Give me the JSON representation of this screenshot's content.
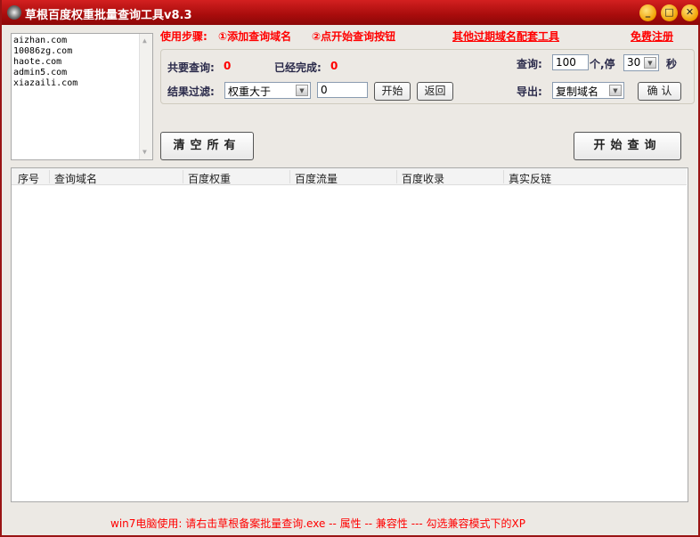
{
  "window": {
    "title": "草根百度权重批量查询工具v8.3"
  },
  "domains": [
    "aizhan.com",
    "10086zg.com",
    "haote.com",
    "admin5.com",
    "xiazaili.com"
  ],
  "steps": {
    "label": "使用步骤:",
    "step1": "①添加查询域名",
    "step2": "②点开始查询按钮"
  },
  "links": {
    "tools": "其他过期域名配套工具",
    "register": "免费注册"
  },
  "stats": {
    "total_label": "共要查询:",
    "total": "0",
    "done_label": "已经完成:",
    "done": "0"
  },
  "filter": {
    "label": "结果过滤:",
    "selected": "权重大于",
    "value": "0",
    "start": "开始",
    "back": "返回"
  },
  "query": {
    "label": "查询:",
    "count": "100",
    "mid": "个,停",
    "pause": "30",
    "unit": "秒"
  },
  "export": {
    "label": "导出:",
    "selected": "复制域名",
    "confirm": "确 认"
  },
  "buttons": {
    "clear": "清空所有",
    "start": "开始查询"
  },
  "table": {
    "columns": [
      "序号",
      "查询域名",
      "百度权重",
      "百度流量",
      "百度收录",
      "真实反链"
    ]
  },
  "footer": "win7电脑使用: 请右击草根备案批量查询.exe -- 属性 -- 兼容性 --- 勾选兼容模式下的XP"
}
